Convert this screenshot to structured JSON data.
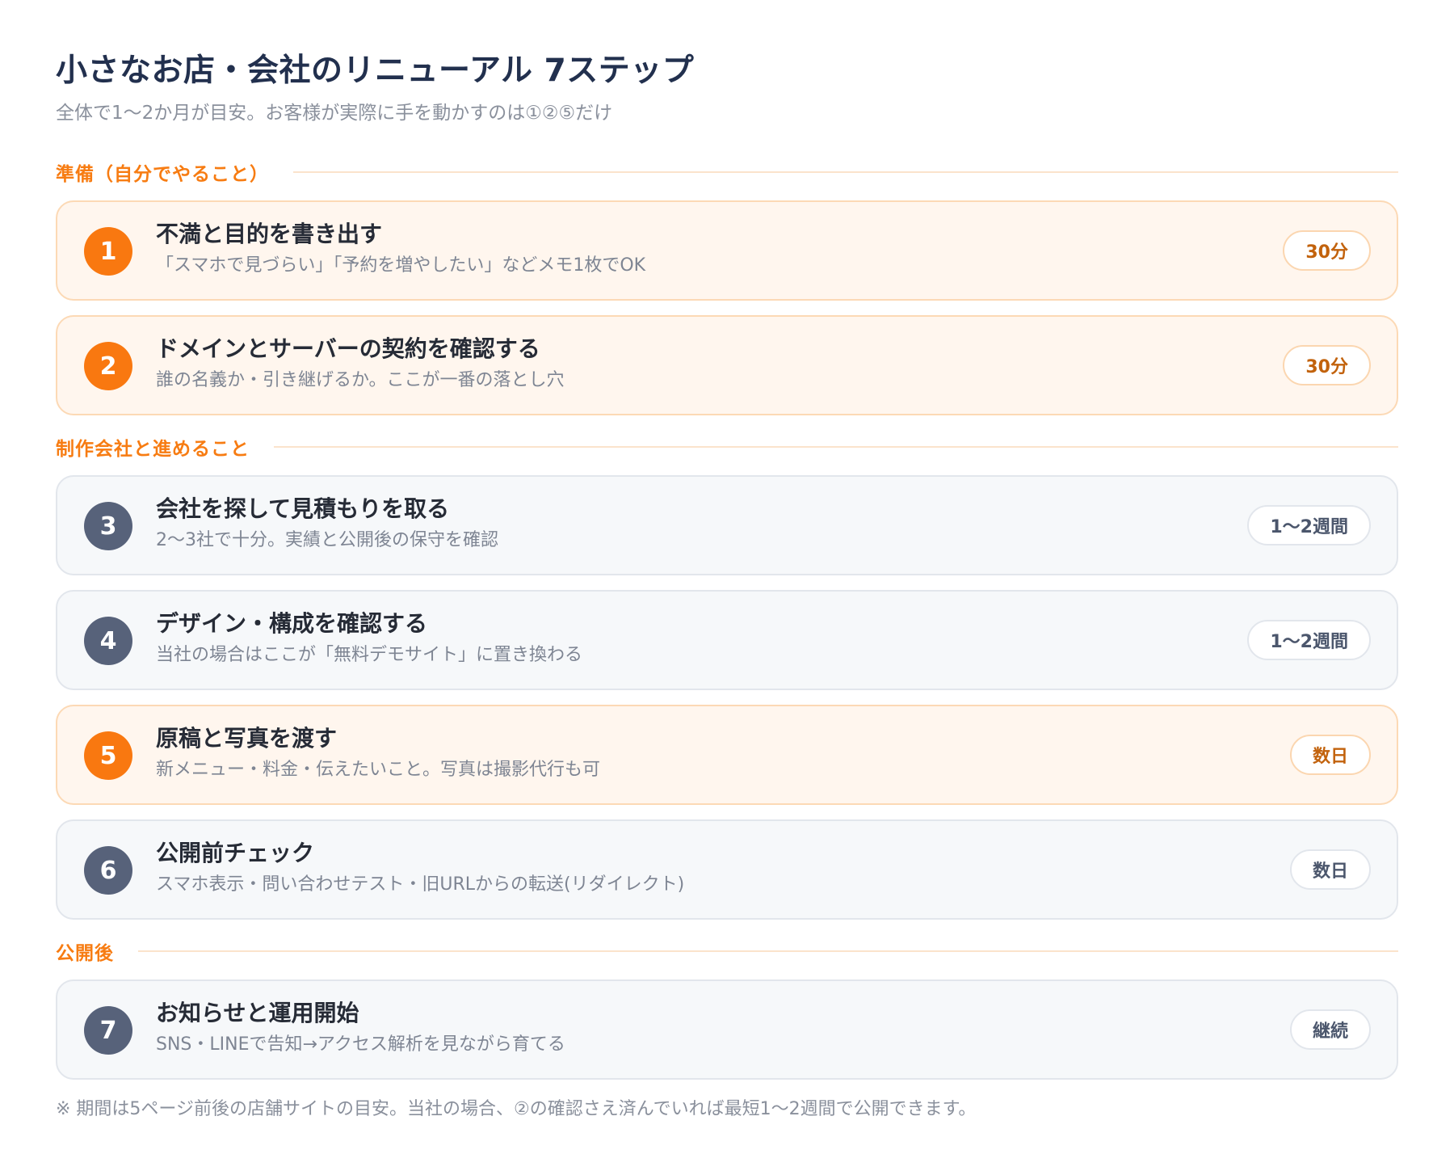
{
  "title": "小さなお店・会社のリニューアル 7ステップ",
  "subtitle": "全体で1〜2か月が目安。お客様が実際に手を動かすのは①②⑤だけ",
  "colors": {
    "accent": "#f97810",
    "neutral_badge": "#57627a",
    "accent_bg": "#fff6ee",
    "neutral_bg": "#f6f8fa"
  },
  "sections": [
    {
      "label": "準備（自分でやること）",
      "steps": [
        {
          "number": "1",
          "title": "不満と目的を書き出す",
          "desc": "「スマホで見づらい」「予約を増やしたい」などメモ1枚でOK",
          "duration": "30分",
          "accent": true
        },
        {
          "number": "2",
          "title": "ドメインとサーバーの契約を確認する",
          "desc": "誰の名義か・引き継げるか。ここが一番の落とし穴",
          "duration": "30分",
          "accent": true
        }
      ]
    },
    {
      "label": "制作会社と進めること",
      "steps": [
        {
          "number": "3",
          "title": "会社を探して見積もりを取る",
          "desc": "2〜3社で十分。実績と公開後の保守を確認",
          "duration": "1〜2週間",
          "accent": false
        },
        {
          "number": "4",
          "title": "デザイン・構成を確認する",
          "desc": "当社の場合はここが「無料デモサイト」に置き換わる",
          "duration": "1〜2週間",
          "accent": false
        },
        {
          "number": "5",
          "title": "原稿と写真を渡す",
          "desc": "新メニュー・料金・伝えたいこと。写真は撮影代行も可",
          "duration": "数日",
          "accent": true
        },
        {
          "number": "6",
          "title": "公開前チェック",
          "desc": "スマホ表示・問い合わせテスト・旧URLからの転送(リダイレクト)",
          "duration": "数日",
          "accent": false
        }
      ]
    },
    {
      "label": "公開後",
      "steps": [
        {
          "number": "7",
          "title": "お知らせと運用開始",
          "desc": "SNS・LINEで告知→アクセス解析を見ながら育てる",
          "duration": "継続",
          "accent": false
        }
      ]
    }
  ],
  "footnote": "※ 期間は5ページ前後の店舗サイトの目安。当社の場合、②の確認さえ済んでいれば最短1〜2週間で公開できます。"
}
